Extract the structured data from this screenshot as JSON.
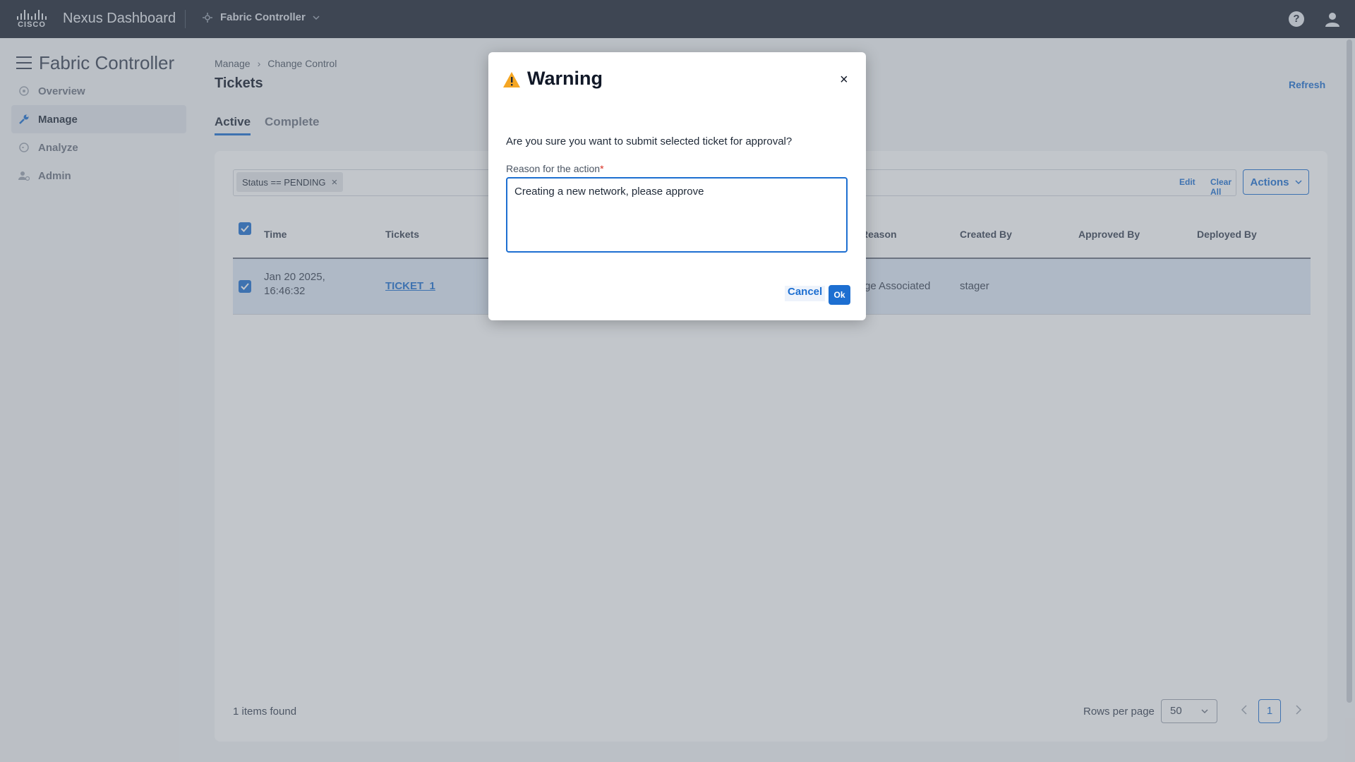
{
  "header": {
    "brand_word": "CISCO",
    "app_name": "Nexus Dashboard",
    "fabric_selector": "Fabric Controller",
    "help_glyph": "?"
  },
  "sidebar": {
    "title": "Fabric Controller",
    "items": [
      {
        "label": "Overview",
        "icon": "overview-icon"
      },
      {
        "label": "Manage",
        "icon": "wrench-icon",
        "active": true
      },
      {
        "label": "Analyze",
        "icon": "analyze-icon"
      },
      {
        "label": "Admin",
        "icon": "admin-icon"
      }
    ]
  },
  "main": {
    "breadcrumb": [
      "Manage",
      "Change Control"
    ],
    "breadcrumb_sep": "›",
    "title": "Tickets",
    "refresh": "Refresh",
    "tabs": [
      {
        "label": "Active",
        "active": true
      },
      {
        "label": "Complete"
      }
    ],
    "filter": {
      "chip": "Status  ==  PENDING",
      "chip_remove": "×",
      "edit": "Edit",
      "clear_all": "Clear All"
    },
    "actions_label": "Actions",
    "table": {
      "columns": [
        "Time",
        "Tickets",
        "Reason",
        "Created By",
        "Approved By",
        "Deployed By"
      ],
      "rows": [
        {
          "time_line1": "Jan 20 2025,",
          "time_line2": "16:46:32",
          "ticket": "TICKET_1",
          "reason": "ge Associated",
          "created_by": "stager",
          "approved_by": "",
          "deployed_by": ""
        }
      ]
    },
    "footer": {
      "items_found": "1 items found",
      "rows_per_page_label": "Rows per page",
      "rows_per_page_value": "50",
      "page": "1"
    }
  },
  "modal": {
    "title": "Warning",
    "close": "×",
    "question": "Are you sure you want to submit selected ticket for approval?",
    "reason_label": "Reason for the action",
    "required_mark": "*",
    "reason_value": "Creating a new network, please approve",
    "cancel": "Cancel",
    "ok": "Ok"
  },
  "colors": {
    "accent": "#1d6fd1",
    "header_bg": "#1c2331",
    "warning": "#f5a623",
    "required": "#d92d20"
  }
}
